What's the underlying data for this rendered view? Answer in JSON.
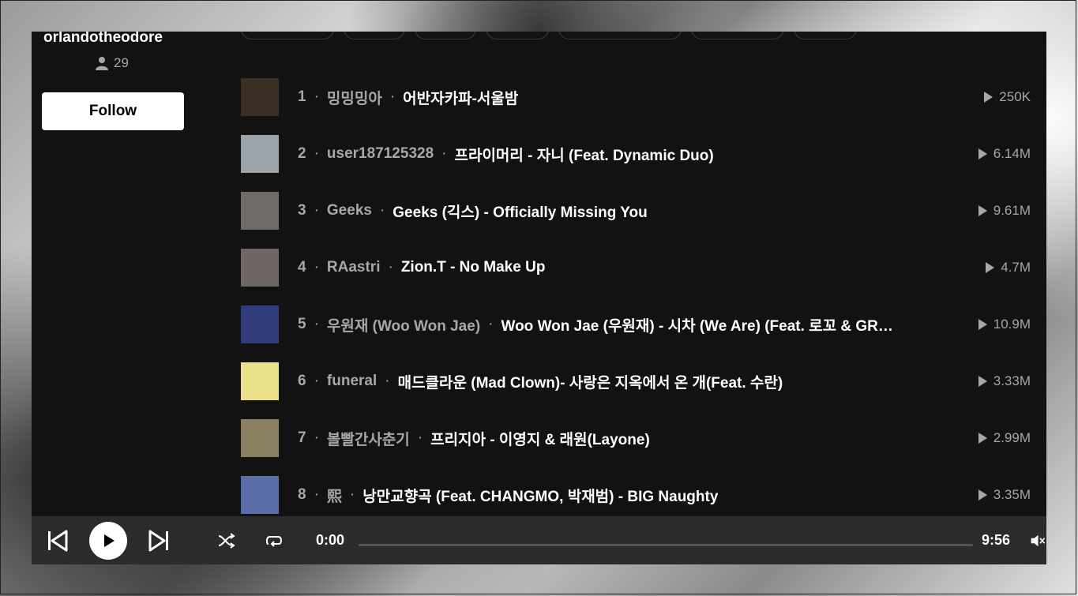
{
  "profile": {
    "username": "orlandotheodore",
    "followers": "29",
    "follow_label": "Follow"
  },
  "tracks": [
    {
      "num": "1",
      "artist": "밍밍밍아",
      "title": "어반자카파-서울밤",
      "plays": "250K",
      "thumb_color": "#3b2e22"
    },
    {
      "num": "2",
      "artist": "user187125328",
      "title": "프라이머리 - 자니 (Feat. Dynamic Duo)",
      "plays": "6.14M",
      "thumb_color": "#9ba3a8"
    },
    {
      "num": "3",
      "artist": "Geeks",
      "title": "Geeks (긱스) - Officially Missing You",
      "plays": "9.61M",
      "thumb_color": "#6d6a68"
    },
    {
      "num": "4",
      "artist": "RAastri",
      "title": "Zion.T - No Make Up",
      "plays": "4.7M",
      "thumb_color": "#6f6663"
    },
    {
      "num": "5",
      "artist": "우원재 (Woo Won Jae)",
      "title": "Woo Won Jae (우원재) - 시차 (We Are) (Feat. 로꼬 & GRAY)",
      "plays": "10.9M",
      "thumb_color": "#2f3b7a"
    },
    {
      "num": "6",
      "artist": "funeral",
      "title": "매드클라운 (Mad Clown)- 사랑은 지옥에서 온 개(Feat. 수란)",
      "plays": "3.33M",
      "thumb_color": "#ece08a"
    },
    {
      "num": "7",
      "artist": "볼빨간사춘기",
      "title": "프리지아 - 이영지 & 래원(Layone)",
      "plays": "2.99M",
      "thumb_color": "#8b7f62"
    },
    {
      "num": "8",
      "artist": "熙",
      "title": "낭만교향곡 (Feat. CHANGMO, 박재범) - BIG Naughty",
      "plays": "3.35M",
      "thumb_color": "#5a6fa8"
    }
  ],
  "player": {
    "current_time": "0:00",
    "duration": "9:56",
    "progress": 0
  }
}
